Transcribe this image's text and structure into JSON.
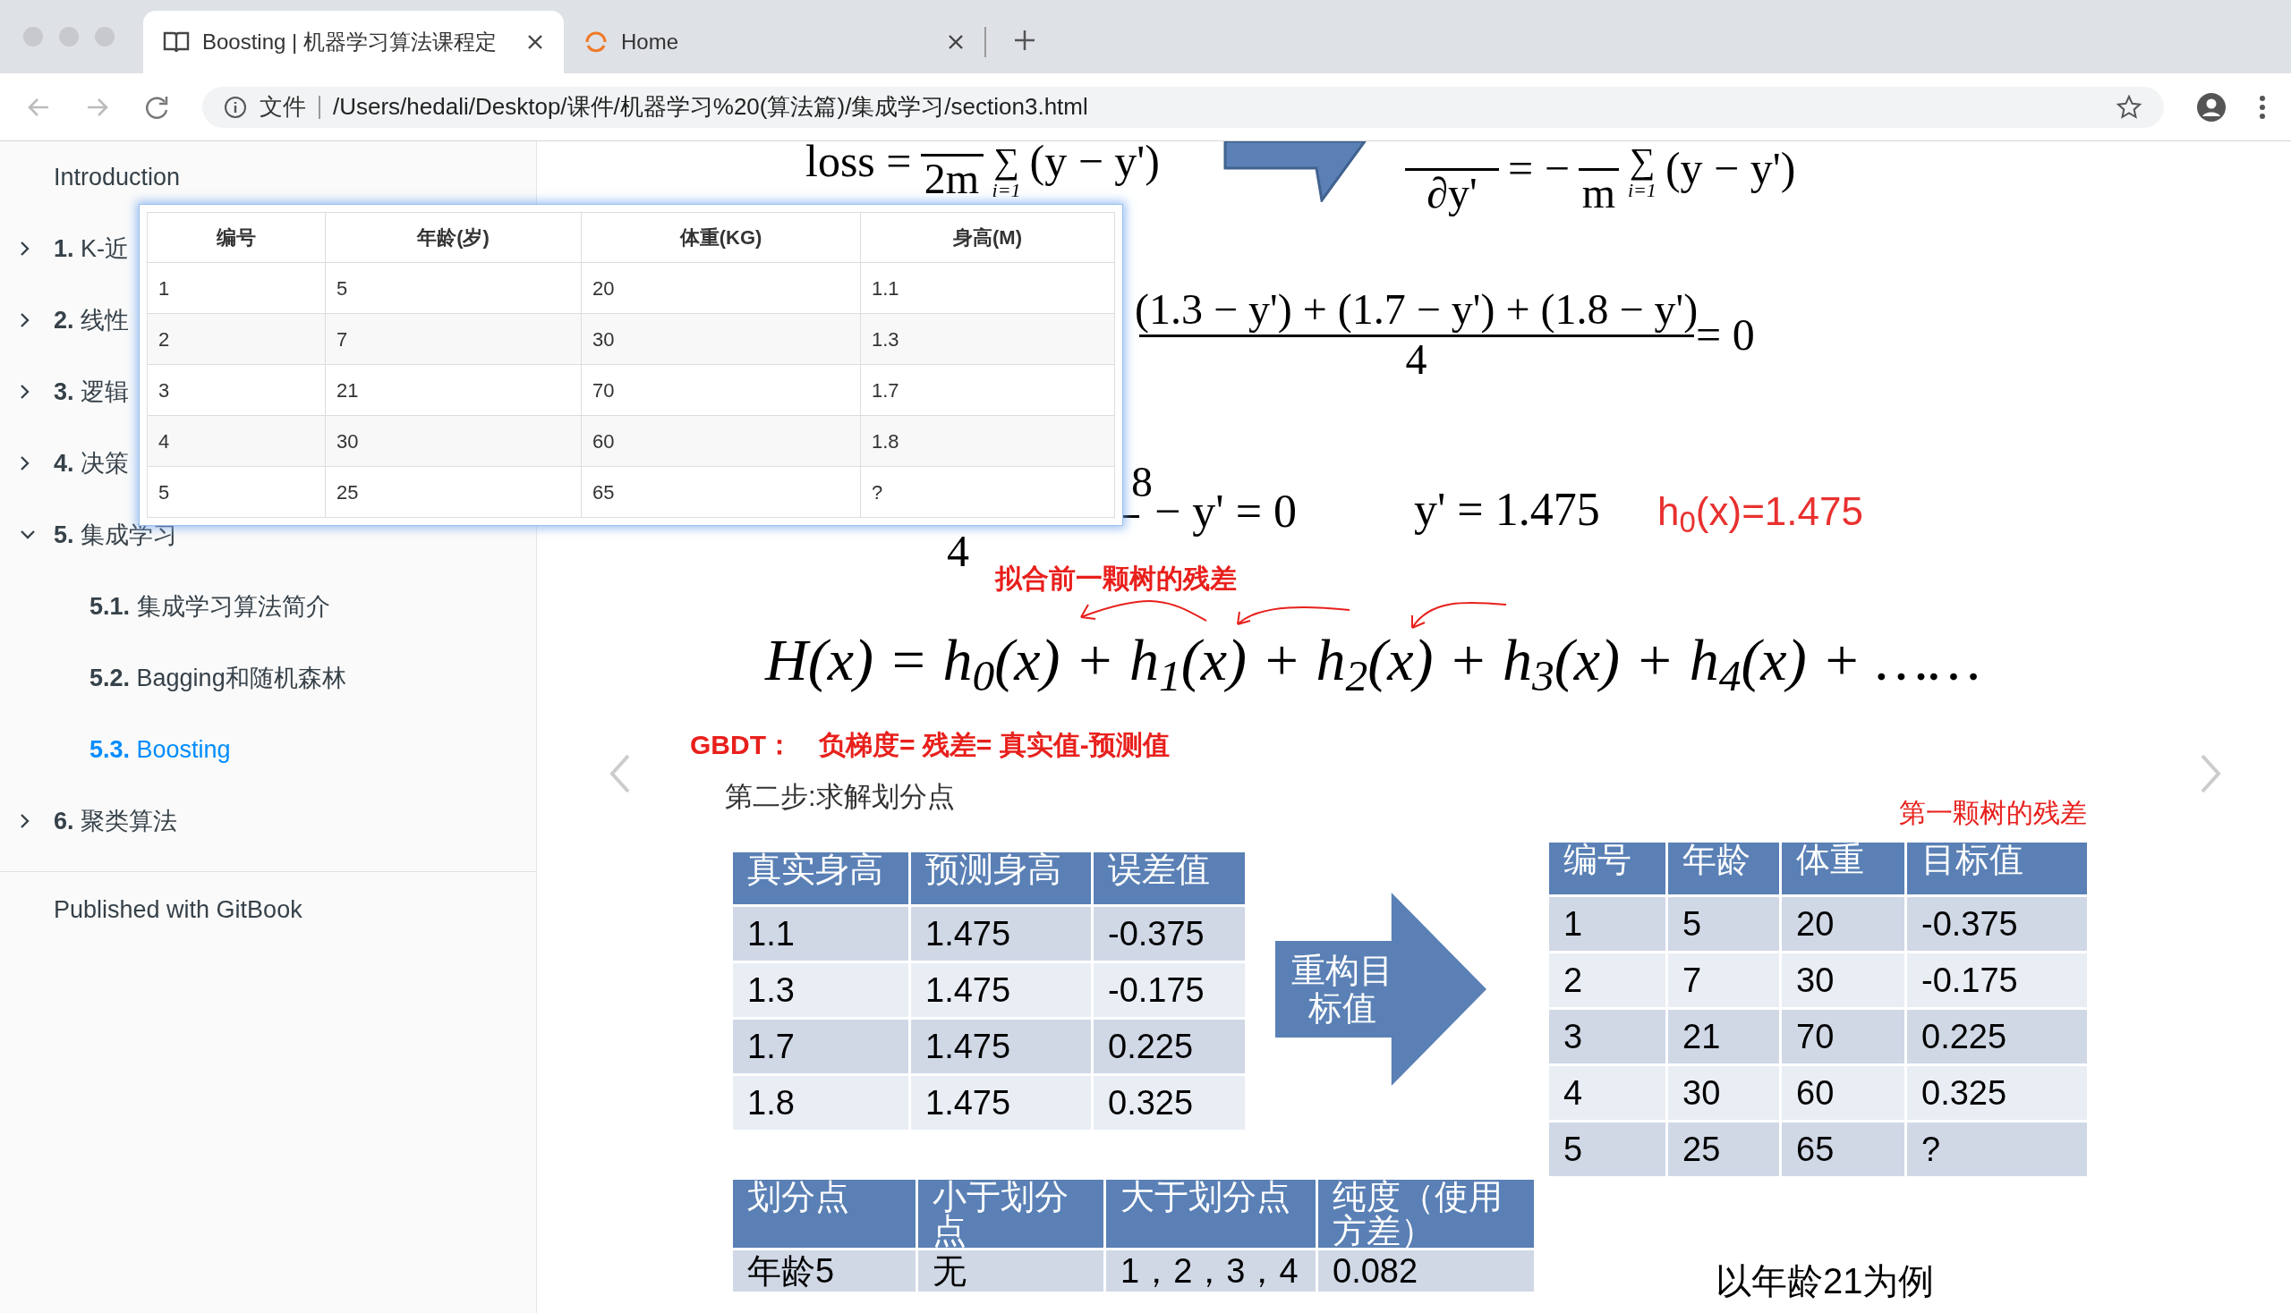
{
  "browser": {
    "tabs": [
      {
        "title": "Boosting | 机器学习算法课程定",
        "selected": true,
        "kind": "book"
      },
      {
        "title": "Home",
        "selected": false,
        "kind": "loading"
      }
    ],
    "address_bar": {
      "scheme": "文件",
      "url": "/Users/hedali/Desktop/课件/机器学习%20(算法篇)/集成学习/section3.html"
    }
  },
  "sidebar": {
    "items": [
      {
        "kind": "link",
        "label": "Introduction",
        "selected": false
      },
      {
        "kind": "chapter",
        "number": "1.",
        "label": "K-近",
        "expanded": false,
        "selected": false
      },
      {
        "kind": "chapter",
        "number": "2.",
        "label": "线性",
        "expanded": false,
        "selected": false
      },
      {
        "kind": "chapter",
        "number": "3.",
        "label": "逻辑",
        "expanded": false,
        "selected": false
      },
      {
        "kind": "chapter",
        "number": "4.",
        "label": "决策",
        "expanded": false,
        "selected": false
      },
      {
        "kind": "chapter",
        "number": "5.",
        "label": "集成学习",
        "expanded": true,
        "selected": false,
        "children": [
          {
            "number": "5.1.",
            "label": "集成学习算法简介",
            "selected": false
          },
          {
            "number": "5.2.",
            "label": "Bagging和随机森林",
            "selected": false
          },
          {
            "number": "5.3.",
            "label": "Boosting",
            "selected": true
          }
        ]
      },
      {
        "kind": "chapter",
        "number": "6.",
        "label": "聚类算法",
        "expanded": false,
        "selected": false
      }
    ],
    "footer": "Published with GitBook"
  },
  "popup_table": {
    "columns": [
      "编号",
      "年龄(岁)",
      "体重(KG)",
      "身高(M)"
    ],
    "rows": [
      [
        "1",
        "5",
        "20",
        "1.1"
      ],
      [
        "2",
        "7",
        "30",
        "1.3"
      ],
      [
        "3",
        "21",
        "70",
        "1.7"
      ],
      [
        "4",
        "30",
        "60",
        "1.8"
      ],
      [
        "5",
        "25",
        "65",
        "?"
      ]
    ]
  },
  "slide": {
    "formula_1": {
      "lhs": "loss =",
      "denominator": "2m",
      "sum_symbol": "∑",
      "sum_index": "i=1",
      "sum_term": "(y − y')"
    },
    "formula_2": {
      "denominator": "∂y'",
      "equals": "= −",
      "coefficient_denominator": "m",
      "sum_symbol": "∑",
      "sum_index": "i=1",
      "sum_term": "(y − y')"
    },
    "formula_3": {
      "numerator": "(1.3 − y') + (1.7 − y') + (1.8 − y')",
      "denominator": "4",
      "rhs": "= 0"
    },
    "formula_4": {
      "numerator": "8",
      "denominator": "4",
      "rhs": "− y' = 0"
    },
    "solution": "y' = 1.475",
    "initial_model": "h$_{0}$(x)=1.475",
    "residual_note": "拟合前一颗树的残差",
    "boosting_formula": "H(x) = h$_{0}$(x) + h$_{1}$(x) + h$_{2}$(x) + h$_{3}$(x) + h$_{4}$(x) + ……",
    "gbdt_label": "GBDT：",
    "gbdt_definition": "负梯度= 残差= 真实值-预测值",
    "step_title": "第二步:求解划分点",
    "first_tree_label": "第一颗树的残差",
    "error_table": {
      "columns": [
        "真实身高",
        "预测身高",
        "误差值"
      ],
      "rows": [
        [
          "1.1",
          "1.475",
          "-0.375"
        ],
        [
          "1.3",
          "1.475",
          "-0.175"
        ],
        [
          "1.7",
          "1.475",
          "0.225"
        ],
        [
          "1.8",
          "1.475",
          "0.325"
        ]
      ]
    },
    "arrow_label": "重构目标值",
    "target_table": {
      "columns": [
        "编号",
        "年龄",
        "体重",
        "目标值"
      ],
      "rows": [
        [
          "1",
          "5",
          "20",
          "-0.375"
        ],
        [
          "2",
          "7",
          "30",
          "-0.175"
        ],
        [
          "3",
          "21",
          "70",
          "0.225"
        ],
        [
          "4",
          "30",
          "60",
          "0.325"
        ],
        [
          "5",
          "25",
          "65",
          "?"
        ]
      ]
    },
    "split_table": {
      "columns": [
        "划分点",
        "小于划分点",
        "大于划分点",
        "纯度（使用方差）"
      ],
      "rows": [
        [
          "年龄5",
          "无",
          "1，2，3，4",
          "0.082"
        ]
      ]
    },
    "example_caption": "以年龄21为例"
  }
}
